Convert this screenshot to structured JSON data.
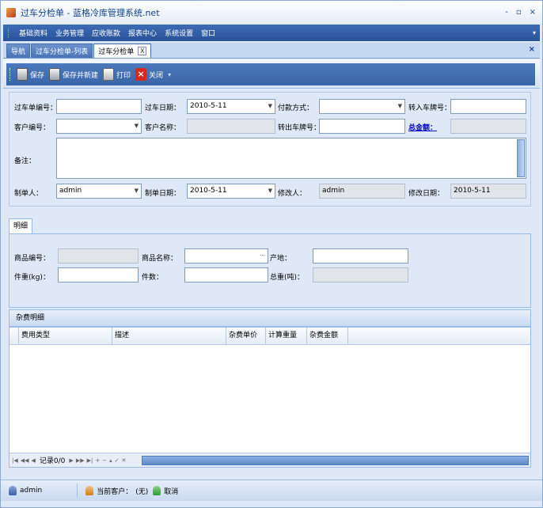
{
  "window": {
    "title": "过车分检单 - 蓝格冷库管理系统.net",
    "controls": [
      "-",
      "▫",
      "×"
    ]
  },
  "menu": {
    "items": [
      "基础资料",
      "业务管理",
      "应收账款",
      "报表中心",
      "系统设置",
      "窗口"
    ]
  },
  "tabs": {
    "items": [
      "导航",
      "过车分检单-列表",
      "过车分检单"
    ],
    "close": "X"
  },
  "toolbar": {
    "save": "保存",
    "save_new": "保存并新建",
    "print": "打印",
    "close": "关闭"
  },
  "form": {
    "transfer_no_label": "过车单编号：",
    "transfer_date_label": "过车日期：",
    "transfer_date_value": "2010-5-11",
    "payment_label": "付款方式：",
    "in_plate_label": "转入车牌号：",
    "customer_no_label": "客户编号：",
    "customer_name_label": "客户名称：",
    "out_plate_label": "转出车牌号：",
    "total_label": "总金额：",
    "remark_label": "备注：",
    "creator_label": "制单人：",
    "creator_value": "admin",
    "create_date_label": "制单日期：",
    "create_date_value": "2010-5-11",
    "modifier_label": "修改人：",
    "modifier_value": "admin",
    "modify_date_label": "修改日期：",
    "modify_date_value": "2010-5-11"
  },
  "detail": {
    "tab_label": "明细",
    "goods_no_label": "商品编号：",
    "goods_name_label": "商品名称：",
    "goods_name_btn": "···",
    "origin_label": "产地：",
    "weight_label": "件重(kg)：",
    "count_label": "件数：",
    "total_weight_label": "总重(吨)："
  },
  "fees": {
    "title": "杂费明细",
    "columns": [
      "费用类型",
      "描述",
      "杂费单价",
      "计算重量",
      "杂费金额"
    ],
    "record_text": "记录0/0"
  },
  "status": {
    "user": "admin",
    "customer_label": "当前客户：",
    "customer_value": "(无)",
    "cancel": "取消"
  }
}
